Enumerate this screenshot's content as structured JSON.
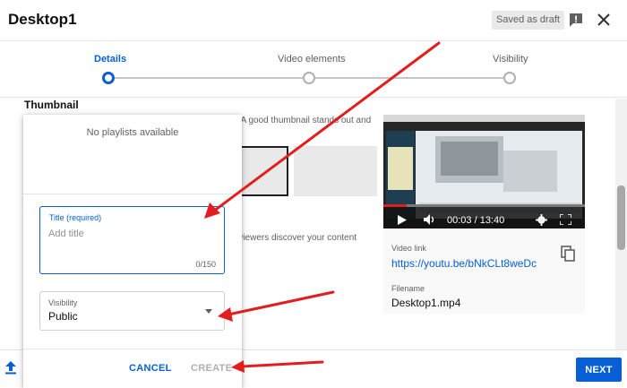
{
  "header": {
    "title": "Desktop1",
    "draft_badge": "Saved as draft"
  },
  "stepper": {
    "steps": [
      {
        "label": "Details",
        "active": true
      },
      {
        "label": "Video elements",
        "active": false
      },
      {
        "label": "Visibility",
        "active": false
      }
    ]
  },
  "background": {
    "section_title": "Thumbnail",
    "thumb_text_partial": "n. A good thumbnail stands out and",
    "viewers_text_partial": "o viewers discover your content"
  },
  "video": {
    "timestamp": "00:03 / 13:40",
    "link_label": "Video link",
    "link_value": "https://youtu.be/bNkCLt8weDc",
    "filename_label": "Filename",
    "filename_value": "Desktop1.mp4"
  },
  "dialog": {
    "no_playlists": "No playlists available",
    "title_field": {
      "label": "Title (required)",
      "placeholder": "Add title",
      "value": "",
      "counter": "0/150"
    },
    "visibility_field": {
      "label": "Visibility",
      "value": "Public"
    },
    "cancel_label": "CANCEL",
    "create_label": "CREATE"
  },
  "footer": {
    "next_label": "NEXT"
  },
  "colors": {
    "accent": "#065fd4",
    "annotation": "#e21d1d"
  }
}
